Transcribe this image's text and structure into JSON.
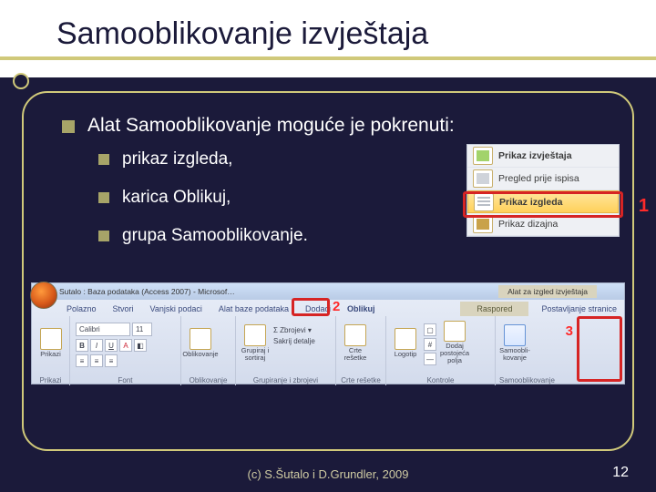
{
  "slide": {
    "title": "Samooblikovanje izvještaja",
    "bullets": {
      "main": "Alat Samooblikovanje moguće je pokrenuti:",
      "sub1": "prikaz izgleda,",
      "sub2": "karica Oblikuj,",
      "sub3": "grupa Samooblikovanje."
    }
  },
  "viewmenu": {
    "items": [
      "Prikaz izvještaja",
      "Pregled prije ispisa",
      "Prikaz izgleda",
      "Prikaz dizajna"
    ]
  },
  "callouts": {
    "one": "1",
    "two": "2",
    "three": "3"
  },
  "ribbon": {
    "titlebar": "Sutalo : Baza podataka (Access 2007) - Microsof…",
    "context_title": "Alat za izgled izvještaja",
    "tabs": [
      "Polazno",
      "Stvori",
      "Vanjski podaci",
      "Alat baze podataka",
      "Dodaci",
      "Oblikuj",
      "Raspored",
      "Postavljanje stranice"
    ],
    "font_name": "Calibri",
    "font_size": "11",
    "groups": {
      "prikazi": "Prikazi",
      "font": "Font",
      "oblikovanje": "Oblikovanje",
      "grupiranje": "Grupiranje i zbrojevi",
      "resetke": "Crte rešetke",
      "kontrole": "Kontrole",
      "samo": "Samooblikovanje"
    },
    "btns": {
      "prikazi": "Prikazi",
      "oblikovanje": "Oblikovanje",
      "grupiraj": "Grupiraj i sortiraj",
      "zbrojevi": "Σ Zbrojevi ▾",
      "sakrij": "Sakrij detalje",
      "resetke": "Crte rešetke",
      "logotip": "Logotip",
      "dodaj": "Dodaj postojeća polja",
      "samo": "Samoobli-kovanje"
    }
  },
  "footer": "(c) S.Šutalo i D.Grundler, 2009",
  "pagenum": "12"
}
